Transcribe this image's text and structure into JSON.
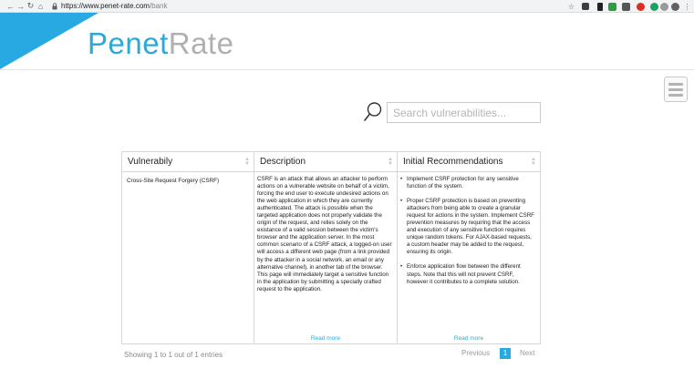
{
  "browser": {
    "url_host": "https://www.penet-rate.com",
    "url_path": "/bank",
    "nav": {
      "back": "←",
      "forward": "→",
      "reload": "↻",
      "home": "⌂"
    },
    "icons": [
      "star-icon",
      "extension-icon",
      "extension-icon",
      "extension-icon",
      "extension-icon",
      "extension-icon",
      "extension-icon",
      "extension-icon",
      "profile-icon",
      "more-icon"
    ]
  },
  "header": {
    "logo_part1": "Penet",
    "logo_part2": "Rate",
    "accent_color": "#29a9e1"
  },
  "search": {
    "placeholder": "Search vulnerabilities..."
  },
  "table": {
    "columns": [
      "Vulnerabily",
      "Description",
      "Initial Recommendations"
    ],
    "rows": [
      {
        "vulnerability": "Cross-Site Request Forgery (CSRF)",
        "description": "CSRF is an attack that allows an attacker to perform actions on a vulnerable website on behalf of a victim, forcing the end user to execute undesired actions on the web application in which they are currently authenticated. The attack is possible when the targeted application does not properly validate the origin of the request, and relies solely on the existance of a valid session between the victim's browser and the application server. In the most common scenario of a CSRF attack, a logged-on user will access a different web page (from a link provided by the attacker in a social network, an email or any alternative channel), in another tab of the browser. This page will immediately target a sensitive function in the application by submitting a specially crafted request to the application.",
        "recommendations": [
          "Implement CSRF protection for any sensitive function of the system.",
          "Proper CSRF protection is based on preventing attackers from being able to create a granular request for actions in the system. Implement CSRF prevention measures by requiring that the access and execution of any sensitive function requires unique random tokens. For AJAX-based requests, a custom header may be added to the request, ensuring its origin.",
          "Enforce application flow between the different steps. Note that this will not prevent CSRF, however it contributes to a complete solution."
        ],
        "read_more": "Read more"
      }
    ]
  },
  "footer": {
    "info": "Showing 1 to 1 out of 1 entries",
    "previous": "Previous",
    "current_page": "1",
    "next": "Next"
  }
}
